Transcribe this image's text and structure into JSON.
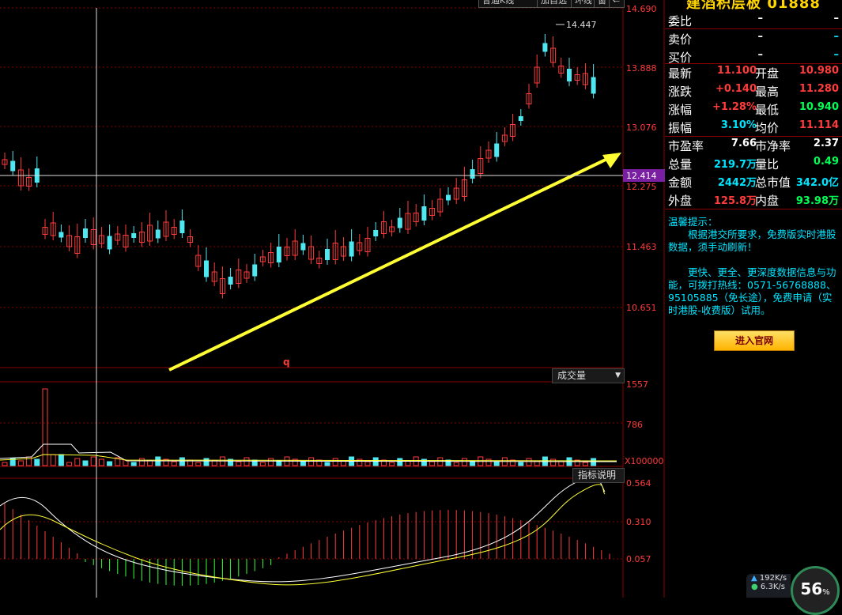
{
  "toolbar": {
    "kline_type": "普通K线",
    "add_watch": "加自选",
    "ring": "环线",
    "window": "窗"
  },
  "main_chart": {
    "price_ticks": [
      "14.690",
      "13.888",
      "13.076",
      "12.275",
      "11.463",
      "10.651"
    ],
    "current_marker": "12.414",
    "high_marker": "14.447",
    "q_mark": "q",
    "colors": {
      "up": "#ff3b3b",
      "down": "#4fe8f0",
      "arrow": "#ffff33",
      "grid": "#8a0000",
      "marker_bg": "#7b1fa2"
    }
  },
  "volume_panel": {
    "selector_label": "成交量",
    "ticks": [
      "1557",
      "786"
    ],
    "unit": "X100000"
  },
  "indicator_panel": {
    "explain_label": "指标说明",
    "ticks": [
      "0.564",
      "0.310",
      "0.057"
    ]
  },
  "quote": {
    "title": "建滔积层板 01888",
    "rows": [
      {
        "l1": "委比",
        "v1": "–",
        "l2": "",
        "v2": "–",
        "c1": "#ffffff",
        "c2": "#ffffff"
      },
      {
        "l1": "卖价",
        "v1": "–",
        "l2": "",
        "v2": "–",
        "c1": "#ffffff",
        "c2": "#00e5ff"
      },
      {
        "l1": "买价",
        "v1": "–",
        "l2": "",
        "v2": "–",
        "c1": "#ffffff",
        "c2": "#00e5ff"
      },
      {
        "l1": "最新",
        "v1": "11.100",
        "l2": "开盘",
        "v2": "10.980",
        "c1": "#ff3b3b",
        "c2": "#ff3b3b"
      },
      {
        "l1": "涨跌",
        "v1": "+0.140",
        "l2": "最高",
        "v2": "11.280",
        "c1": "#ff3b3b",
        "c2": "#ff3b3b"
      },
      {
        "l1": "涨幅",
        "v1": "+1.28%",
        "l2": "最低",
        "v2": "10.940",
        "c1": "#ff3b3b",
        "c2": "#00ff55"
      },
      {
        "l1": "振幅",
        "v1": "3.10%",
        "l2": "均价",
        "v2": "11.114",
        "c1": "#00e5ff",
        "c2": "#ff3b3b"
      },
      {
        "l1": "市盈率",
        "v1": "7.66",
        "l2": "市净率",
        "v2": "2.37",
        "c1": "#ffffff",
        "c2": "#ffffff"
      },
      {
        "l1": "总量",
        "v1": "219.7万",
        "l2": "量比",
        "v2": "0.49",
        "c1": "#00e5ff",
        "c2": "#00ff55"
      },
      {
        "l1": "金额",
        "v1": "2442万",
        "l2": "总市值",
        "v2": "342.0亿",
        "c1": "#00e5ff",
        "c2": "#00e5ff"
      },
      {
        "l1": "外盘",
        "v1": "125.8万",
        "l2": "内盘",
        "v2": "93.98万",
        "c1": "#ff3b3b",
        "c2": "#00ff55"
      }
    ]
  },
  "tips": {
    "heading": "温馨提示：",
    "line1": "　　根据港交所要求，免费版实时港股数据，须手动刷新！",
    "line2": "　　更快、更全、更深度数据信息与功能，可拨打热线：0571-56768888、95105885（免长途），免费申请（实时港股-收费版）试用。",
    "button": "进入官网"
  },
  "status": {
    "download_speed": "192K/s",
    "upload_speed": "6.3K/s",
    "gauge_value": "56",
    "gauge_unit": "%"
  }
}
